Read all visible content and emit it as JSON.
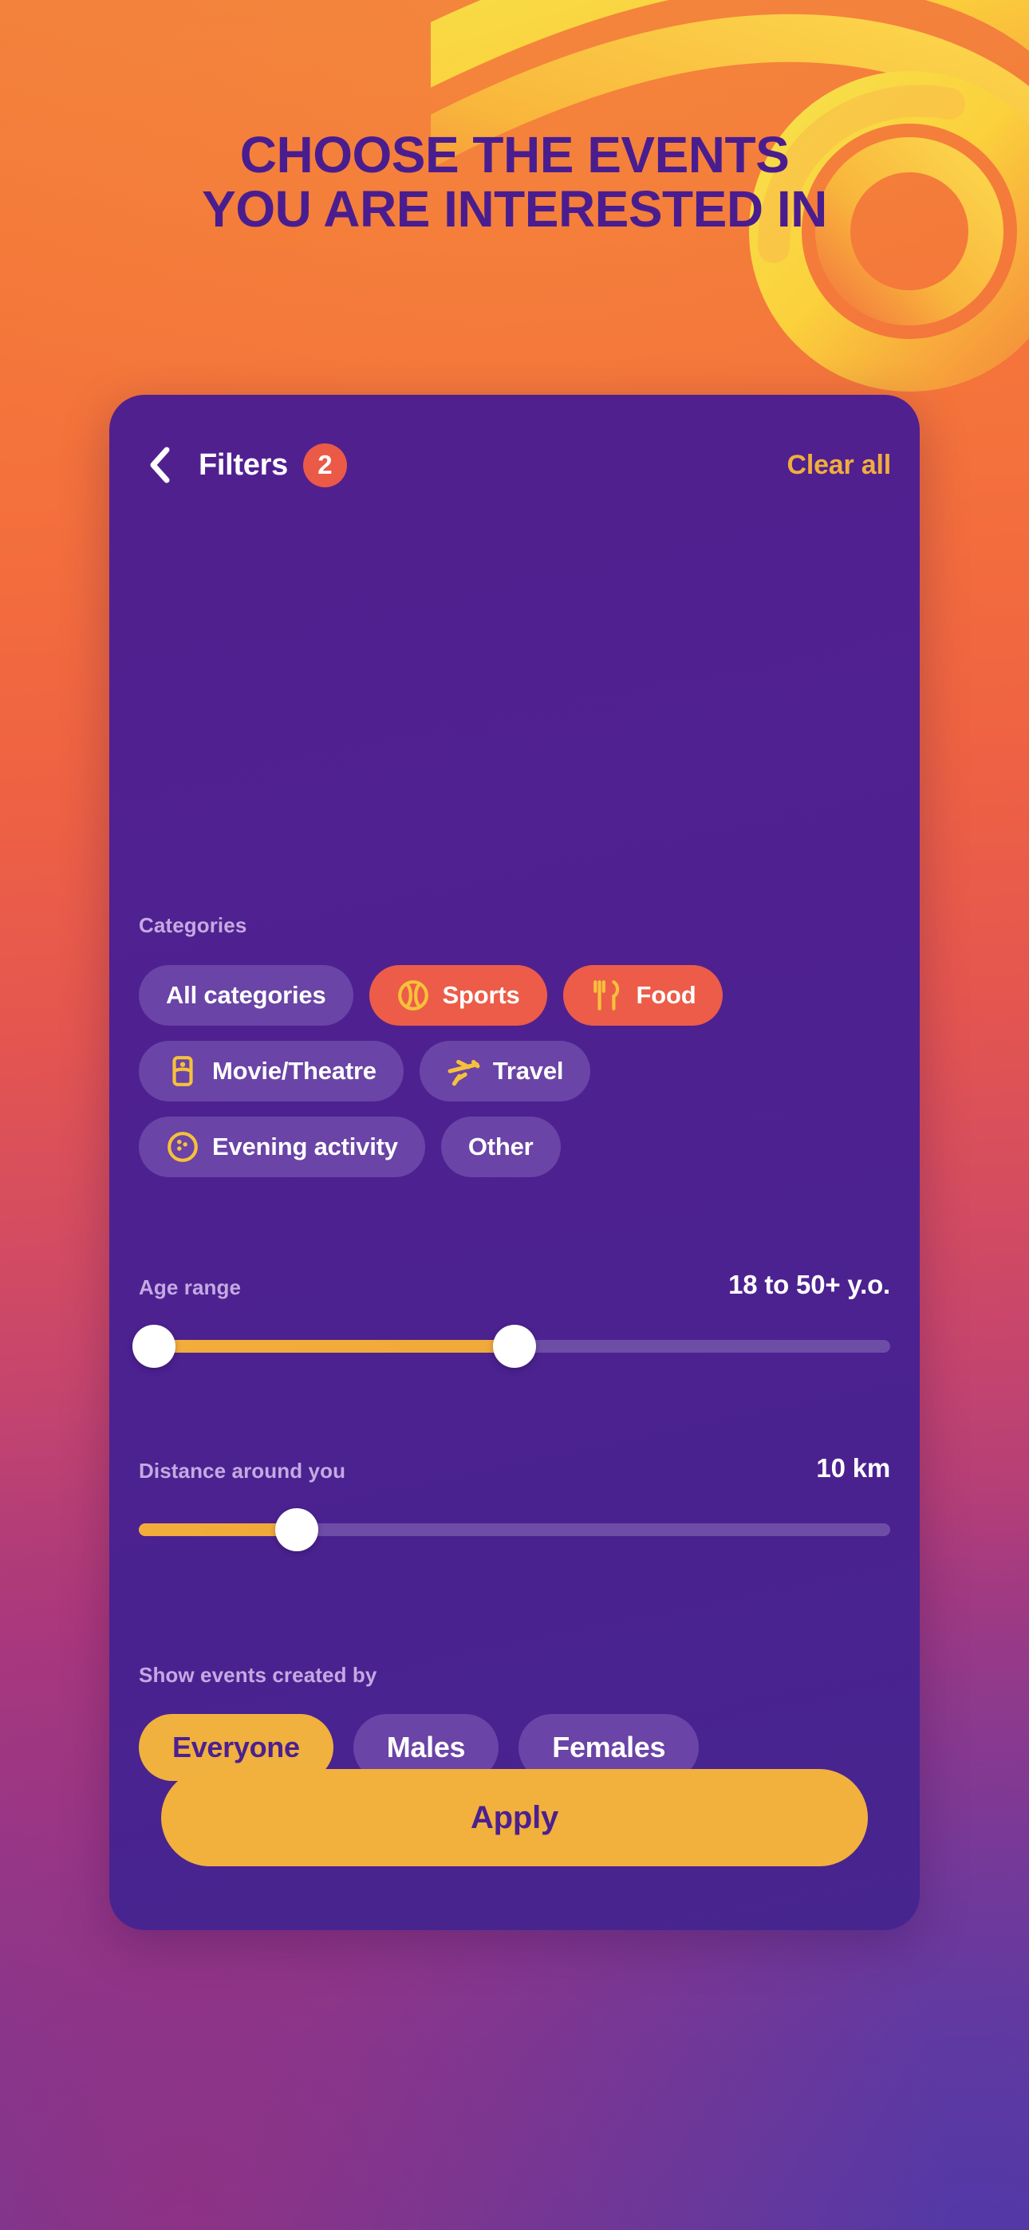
{
  "theme": {
    "brand_purple": "#4a1d8f",
    "card_purple": "#51208f",
    "accent_yellow": "#f2b03d",
    "accent_red": "#ec5c48",
    "chip_idle": "#6a44a6",
    "label_lavender": "#c5a9e2",
    "bg_orange": "#f2813c",
    "bg_magenta": "#a83a7f"
  },
  "promo": {
    "headline_line1": "CHOOSE THE EVENTS",
    "headline_line2": "YOU ARE INTERESTED IN",
    "swirl_icon": "spiral-ribbon-decoration"
  },
  "header": {
    "back_icon": "chevron-left-icon",
    "title": "Filters",
    "active_filter_count": "2",
    "clear_all_label": "Clear all"
  },
  "categories": {
    "label": "Categories",
    "rows": [
      [
        {
          "label": "All categories",
          "icon": null,
          "selected": false
        },
        {
          "label": "Sports",
          "icon": "tennis-ball-icon",
          "selected": true
        },
        {
          "label": "Food",
          "icon": "fork-knife-icon",
          "selected": true
        }
      ],
      [
        {
          "label": "Movie/Theatre",
          "icon": "ticket-icon",
          "selected": false
        },
        {
          "label": "Travel",
          "icon": "airplane-icon",
          "selected": false
        }
      ],
      [
        {
          "label": "Evening activity",
          "icon": "bowling-ball-icon",
          "selected": false
        },
        {
          "label": "Other",
          "icon": null,
          "selected": false
        }
      ]
    ]
  },
  "age_range": {
    "label": "Age range",
    "value": "18 to 50+ y.o.",
    "min_percent": 2,
    "max_percent": 50
  },
  "distance": {
    "label": "Distance around you",
    "value": "10 km",
    "percent": 21
  },
  "creator": {
    "label": "Show events created by",
    "options": [
      {
        "label": "Everyone",
        "selected": true
      },
      {
        "label": "Males",
        "selected": false
      },
      {
        "label": "Females",
        "selected": false
      }
    ]
  },
  "footer": {
    "apply_label": "Apply"
  }
}
